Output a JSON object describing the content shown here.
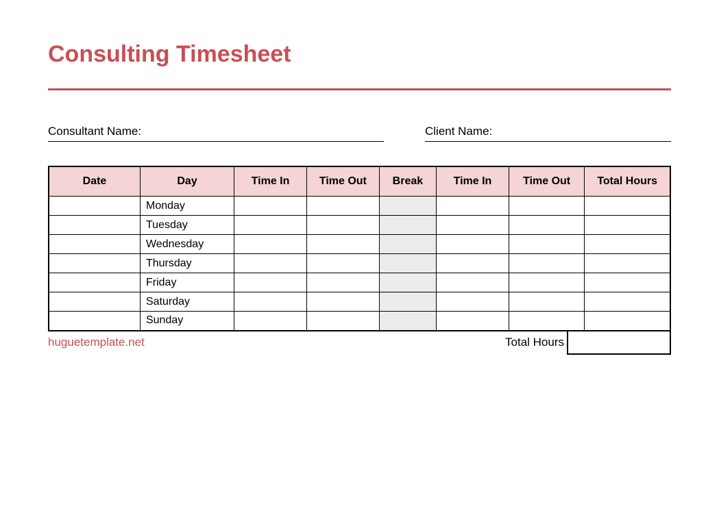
{
  "title": "Consulting Timesheet",
  "labels": {
    "consultant_name": "Consultant Name:",
    "client_name": "Client Name:",
    "total_hours_footer": "Total Hours"
  },
  "columns": [
    "Date",
    "Day",
    "Time In",
    "Time Out",
    "Break",
    "Time In",
    "Time Out",
    "Total Hours"
  ],
  "rows": [
    {
      "date": "",
      "day": "Monday",
      "time_in_1": "",
      "time_out_1": "",
      "break": "",
      "time_in_2": "",
      "time_out_2": "",
      "total": ""
    },
    {
      "date": "",
      "day": "Tuesday",
      "time_in_1": "",
      "time_out_1": "",
      "break": "",
      "time_in_2": "",
      "time_out_2": "",
      "total": ""
    },
    {
      "date": "",
      "day": "Wednesday",
      "time_in_1": "",
      "time_out_1": "",
      "break": "",
      "time_in_2": "",
      "time_out_2": "",
      "total": ""
    },
    {
      "date": "",
      "day": "Thursday",
      "time_in_1": "",
      "time_out_1": "",
      "break": "",
      "time_in_2": "",
      "time_out_2": "",
      "total": ""
    },
    {
      "date": "",
      "day": "Friday",
      "time_in_1": "",
      "time_out_1": "",
      "break": "",
      "time_in_2": "",
      "time_out_2": "",
      "total": ""
    },
    {
      "date": "",
      "day": "Saturday",
      "time_in_1": "",
      "time_out_1": "",
      "break": "",
      "time_in_2": "",
      "time_out_2": "",
      "total": ""
    },
    {
      "date": "",
      "day": "Sunday",
      "time_in_1": "",
      "time_out_1": "",
      "break": "",
      "time_in_2": "",
      "time_out_2": "",
      "total": ""
    }
  ],
  "grand_total": "",
  "footer_link": "huguetemplate.net"
}
